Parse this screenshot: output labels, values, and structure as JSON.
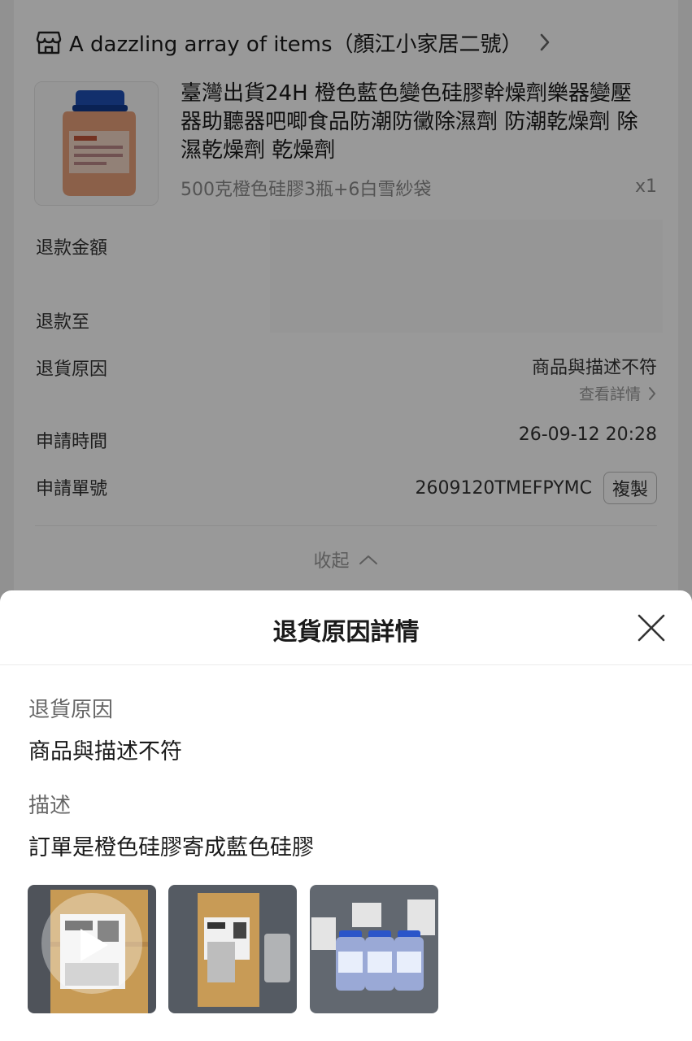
{
  "shop": {
    "name": "A dazzling array of items（顏江小家居二號）",
    "icon": "shop-icon"
  },
  "product": {
    "title": "臺灣出貨24H 橙色藍色變色硅膠幹燥劑樂器變壓器助聽器吧唧食品防潮防黴除濕劑 防潮乾燥劑 除濕乾燥劑 乾燥劑",
    "variant": "500克橙色硅膠3瓶+6白雪紗袋",
    "qty": "x1"
  },
  "refund": {
    "amount_label": "退款金額",
    "to_label": "退款至",
    "reason_label": "退貨原因",
    "reason_value": "商品與描述不符",
    "view_details": "查看詳情",
    "time_label": "申請時間",
    "time_value": "26-09-12 20:28",
    "id_label": "申請單號",
    "id_value": "2609120TMEFPYMC",
    "copy_label": "複製",
    "collapse_label": "收起"
  },
  "sheet": {
    "title": "退貨原因詳情",
    "reason_label": "退貨原因",
    "reason_value": "商品與描述不符",
    "desc_label": "描述",
    "desc_value": "訂單是橙色硅膠寄成藍色硅膠",
    "media": [
      "video",
      "photo",
      "photo"
    ]
  },
  "colors": {
    "overlay": "rgba(0,0,0,0.40)",
    "text": "#1a1a1a",
    "muted": "#999999"
  }
}
